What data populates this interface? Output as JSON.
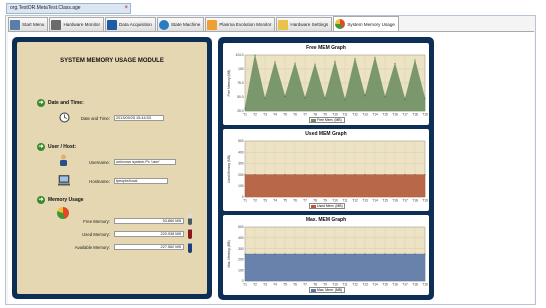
{
  "title_tab": "org.TestOR.MetaTest.Class.age",
  "tabs": [
    {
      "label": "Start Menu",
      "icon": "start-menu-icon",
      "color": "#5a7ea8"
    },
    {
      "label": "Hardware Monitor",
      "icon": "hardware-monitor-icon",
      "color": "#6b6b6b"
    },
    {
      "label": "Data Acquisition",
      "icon": "data-acquisition-icon",
      "color": "#1d5aa8"
    },
    {
      "label": "State Machine",
      "icon": "state-machine-icon",
      "color": "#2a7bc2"
    },
    {
      "label": "Plasma Evolution Monitor",
      "icon": "plasma-monitor-icon",
      "color": "#f0a030"
    },
    {
      "label": "Hardware Settings",
      "icon": "hardware-settings-icon",
      "color": "#e8c24a"
    },
    {
      "label": "System Memory Usage",
      "icon": "memory-pie-icon",
      "color": "#e04a2a"
    }
  ],
  "module": {
    "title": "SYSTEM MEMORY USAGE MODULE",
    "date_section": "Date and Time:",
    "date_label": "Date and Time:",
    "date_value": "2013/09/25 15:44:53",
    "user_section": "User / Host:",
    "username_label": "Username:",
    "username_value": "unknown system.Pc 'user'",
    "hostname_label": "Hostname:",
    "hostname_value": "tpeople/local",
    "memory_section": "Memory Usage",
    "free_label": "Free Memory:",
    "free_value": "53.860 MB",
    "used_label": "Used Memory:",
    "used_value": "220.938 MB",
    "available_label": "Available Memory:",
    "available_value": "227.562 MB"
  },
  "chart_data": [
    {
      "type": "area",
      "title": "Free MEM Graph",
      "xlabel": "Time (s)",
      "ylabel": "Free Memory (MB)",
      "categories": [
        "T1",
        "T2",
        "T3",
        "T4",
        "T5",
        "T6",
        "T7",
        "T8",
        "T9",
        "T10",
        "T11",
        "T12",
        "T13",
        "T14",
        "T15",
        "T16",
        "T17",
        "T18",
        "T19"
      ],
      "values": [
        30,
        124,
        47,
        112,
        51,
        110,
        48,
        108,
        47,
        113,
        45,
        118,
        52,
        120,
        50,
        109,
        46,
        115,
        47
      ],
      "yticks": [
        "124.0",
        "100",
        "75.0",
        "50.0",
        "25.0"
      ],
      "ylim": [
        25,
        124
      ],
      "legend": "Free Mem. (MB)",
      "color": "#6f8f63",
      "plot_bg": "#ece2c4",
      "grid": true
    },
    {
      "type": "area",
      "title": "Used MEM Graph",
      "xlabel": "Time (s)",
      "ylabel": "Used Memory (MB)",
      "categories": [
        "T1",
        "T2",
        "T3",
        "T4",
        "T5",
        "T6",
        "T7",
        "T8",
        "T9",
        "T10",
        "T11",
        "T12",
        "T13",
        "T14",
        "T15",
        "T16",
        "T17",
        "T18",
        "T19"
      ],
      "values": [
        200,
        200,
        200,
        200,
        200,
        200,
        200,
        200,
        200,
        200,
        200,
        200,
        200,
        200,
        200,
        200,
        200,
        200,
        200
      ],
      "yticks": [
        "500",
        "400",
        "300",
        "200",
        "100",
        "0"
      ],
      "ylim": [
        0,
        500
      ],
      "legend": "Used Mem. (MB)",
      "color": "#b45a3c",
      "plot_bg": "#ece2c4",
      "grid": true
    },
    {
      "type": "area",
      "title": "Max. MEM Graph",
      "xlabel": "Time (s)",
      "ylabel": "Max. Memory (MB)",
      "categories": [
        "T1",
        "T2",
        "T3",
        "T4",
        "T5",
        "T6",
        "T7",
        "T8",
        "T9",
        "T10",
        "T11",
        "T12",
        "T13",
        "T14",
        "T15",
        "T16",
        "T17",
        "T18",
        "T19"
      ],
      "values": [
        250,
        250,
        250,
        250,
        250,
        250,
        250,
        250,
        250,
        250,
        250,
        250,
        250,
        250,
        250,
        250,
        250,
        250,
        250
      ],
      "yticks": [
        "500",
        "400",
        "300",
        "200",
        "100",
        "0"
      ],
      "ylim": [
        0,
        500
      ],
      "legend": "Max. Mem. (MB)",
      "color": "#5b78a8",
      "plot_bg": "#ece2c4",
      "grid": true
    }
  ]
}
